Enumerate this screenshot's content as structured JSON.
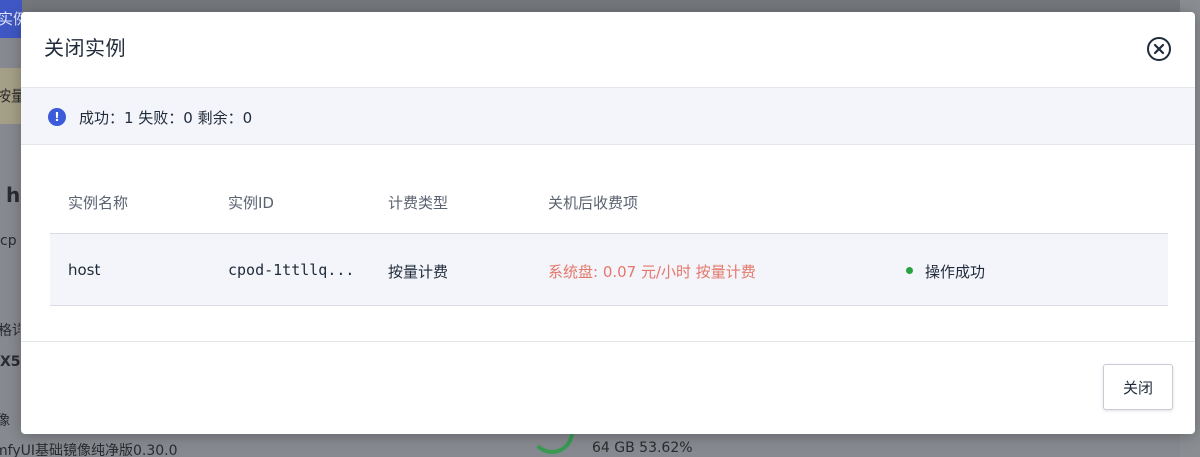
{
  "background": {
    "top_button": "实例",
    "banner_text": "按量",
    "heading_fragment": "h",
    "sub_fragment": "cp",
    "label_fragment": "格详",
    "value_fragment": "X5",
    "label2_fragment": "像",
    "bottom_left": "mfyUI基础镜像纯净版0.30.0",
    "bottom_right": "64 GB 53.62%"
  },
  "modal": {
    "title": "关闭实例",
    "close_icon": "circle-x-icon",
    "status": {
      "icon": "info-icon",
      "text": "成功：1 失败：0 剩余：0"
    },
    "table": {
      "columns": [
        "实例名称",
        "实例ID",
        "计费类型",
        "关机后收费项"
      ],
      "rows": [
        {
          "name": "host",
          "id": "cpod-1ttllq...",
          "billing": "按量计费",
          "fee_after_shutdown": "系统盘: 0.07 元/小时 按量计费",
          "result": "操作成功",
          "result_color": "#26a33f"
        }
      ]
    },
    "footer": {
      "close_button": "关闭"
    }
  },
  "colors": {
    "accent": "#3b5bdb",
    "fee_text": "#e4776b",
    "success": "#26a33f"
  }
}
